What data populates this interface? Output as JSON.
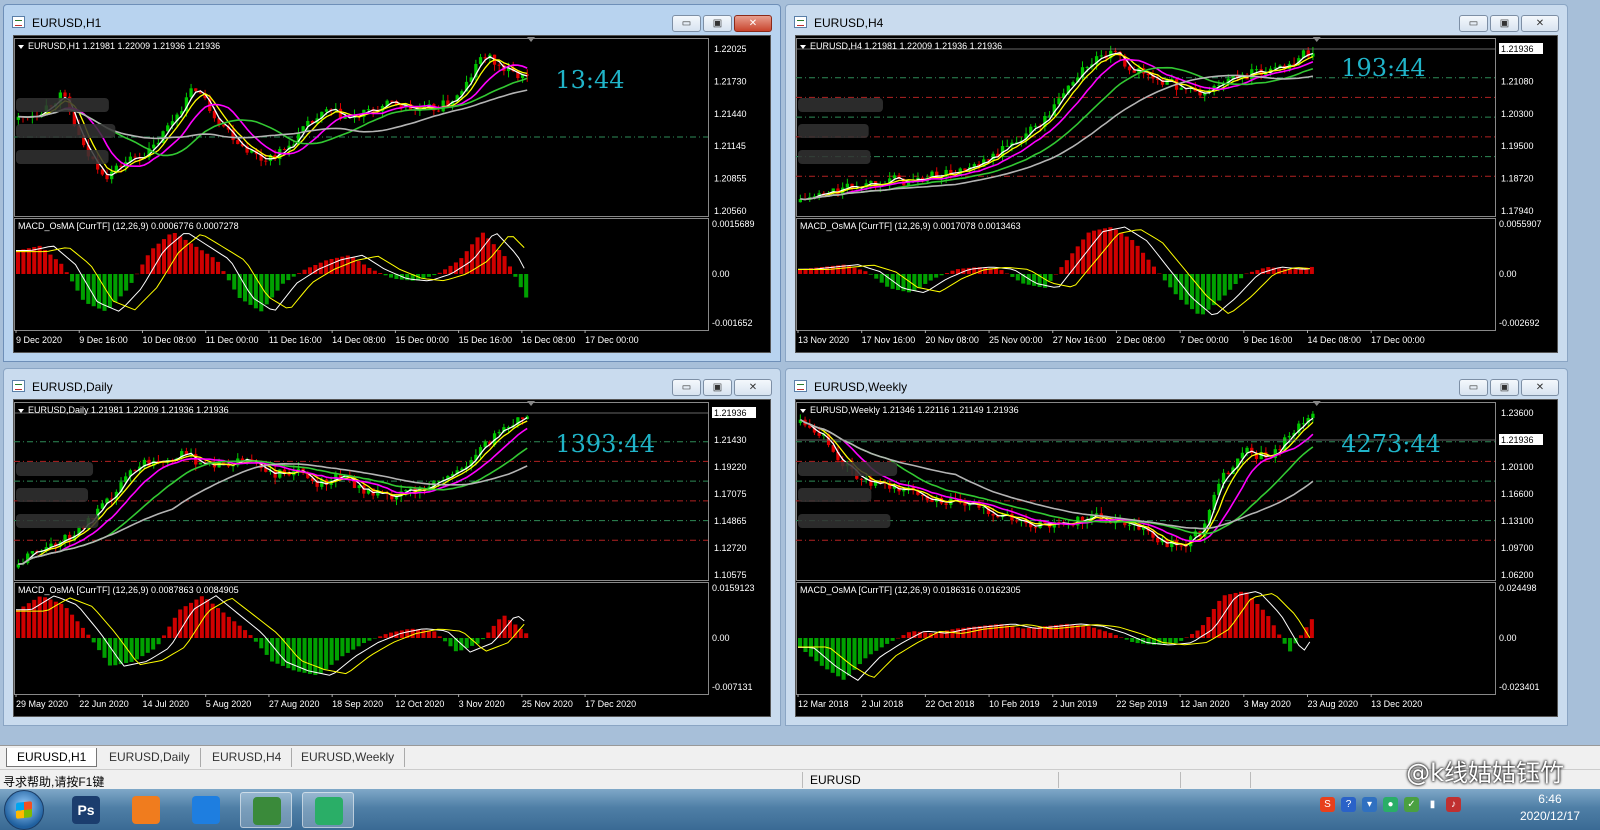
{
  "colors": {
    "chart_bg": "#000000",
    "bull": "#00c800",
    "bear": "#e00000",
    "ma_white": "#ffffff",
    "ma_yellow": "#ffff00",
    "ma_magenta": "#ff00ff",
    "ma_green": "#32c832",
    "ma_gray": "#b4b4b4",
    "timer": "#20b4c8"
  },
  "windows": [
    {
      "id": "h1",
      "title": "EURUSD,H1",
      "active": true,
      "info": "EURUSD,H1  1.21981 1.22009 1.21936 1.21936",
      "timer": "13:44",
      "price_scale": [
        "1.22025",
        "1.21730",
        "1.21440",
        "1.21145",
        "1.20855",
        "1.20560"
      ],
      "current_price": "1.21936",
      "macd_label": "MACD_OsMA [CurrTF] (12,26,9) 0.0006776 0.0007278",
      "macd_scale": [
        "0.0015689",
        "0.00",
        "-0.001652"
      ],
      "time_axis": [
        "9 Dec 2020",
        "9 Dec 16:00",
        "10 Dec 08:00",
        "11 Dec 00:00",
        "11 Dec 16:00",
        "14 Dec 08:00",
        "15 Dec 00:00",
        "15 Dec 16:00",
        "16 Dec 08:00",
        "17 Dec 00:00"
      ]
    },
    {
      "id": "h4",
      "title": "EURUSD,H4",
      "active": false,
      "info": "EURUSD,H4  1.21981 1.22009 1.21936 1.21936",
      "timer": "193:44",
      "price_scale": [
        "1.21936",
        "1.21080",
        "1.20300",
        "1.19500",
        "1.18720",
        "1.17940"
      ],
      "current_price": "1.21936",
      "macd_label": "MACD_OsMA [CurrTF] (12,26,9) 0.0017078 0.0013463",
      "macd_scale": [
        "0.0055907",
        "0.00",
        "-0.002692"
      ],
      "time_axis": [
        "13 Nov 2020",
        "17 Nov 16:00",
        "20 Nov 08:00",
        "25 Nov 00:00",
        "27 Nov 16:00",
        "2 Dec 08:00",
        "7 Dec 00:00",
        "9 Dec 16:00",
        "14 Dec 08:00",
        "17 Dec 00:00"
      ]
    },
    {
      "id": "daily",
      "title": "EURUSD,Daily",
      "active": false,
      "info": "EURUSD,Daily  1.21981 1.22009 1.21936 1.21936",
      "timer": "1393:44",
      "price_scale": [
        "1.21936",
        "1.21430",
        "1.19220",
        "1.17075",
        "1.14865",
        "1.12720",
        "1.10575"
      ],
      "current_price": "1.21936",
      "macd_label": "MACD_OsMA [CurrTF] (12,26,9) 0.0087863 0.0084905",
      "macd_scale": [
        "0.0159123",
        "0.00",
        "-0.007131"
      ],
      "time_axis": [
        "29 May 2020",
        "22 Jun 2020",
        "14 Jul 2020",
        "5 Aug 2020",
        "27 Aug 2020",
        "18 Sep 2020",
        "12 Oct 2020",
        "3 Nov 2020",
        "25 Nov 2020",
        "17 Dec 2020"
      ]
    },
    {
      "id": "weekly",
      "title": "EURUSD,Weekly",
      "active": false,
      "info": "EURUSD,Weekly  1.21346 1.22116 1.21149 1.21936",
      "timer": "4273:44",
      "price_scale": [
        "1.23600",
        "1.21936",
        "1.20100",
        "1.16600",
        "1.13100",
        "1.09700",
        "1.06200"
      ],
      "current_price": "1.21936",
      "macd_label": "MACD_OsMA [CurrTF] (12,26,9) 0.0186316 0.0162305",
      "macd_scale": [
        "0.024498",
        "0.00",
        "-0.023401"
      ],
      "time_axis": [
        "12 Mar 2018",
        "2 Jul 2018",
        "22 Oct 2018",
        "10 Feb 2019",
        "2 Jun 2019",
        "22 Sep 2019",
        "12 Jan 2020",
        "3 May 2020",
        "23 Aug 2020",
        "13 Dec 2020"
      ]
    }
  ],
  "window_buttons": {
    "minimize": "▭",
    "maximize": "▣",
    "close": "✕"
  },
  "tabs": [
    "EURUSD,H1",
    "EURUSD,Daily",
    "EURUSD,H4",
    "EURUSD,Weekly"
  ],
  "status": {
    "help": "寻求帮助,请按F1键",
    "symbol": "EURUSD"
  },
  "taskbar": {
    "apps": [
      {
        "name": "photoshop",
        "label": "Ps",
        "color": "#1b3d6e"
      },
      {
        "name": "media",
        "label": "",
        "color": "#f07c1e"
      },
      {
        "name": "meeting",
        "label": "",
        "color": "#1e7ee0"
      },
      {
        "name": "metatrader",
        "label": "",
        "color": "#3a8a3a"
      },
      {
        "name": "wechat",
        "label": "",
        "color": "#2aae67"
      }
    ],
    "time": "6:46",
    "date": "2020/12/17"
  },
  "watermark": "@k线姑姑钰竹"
}
